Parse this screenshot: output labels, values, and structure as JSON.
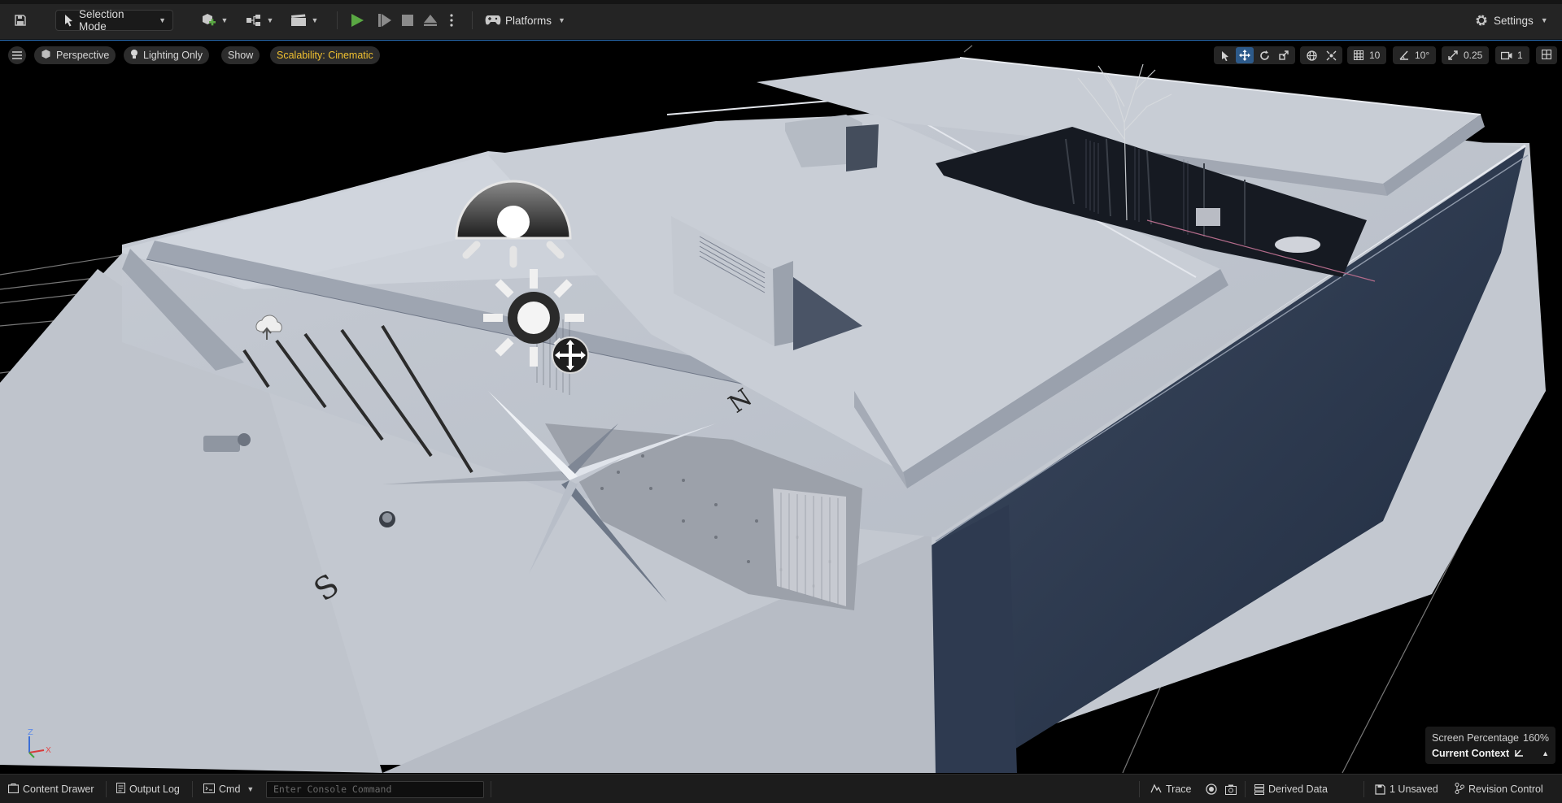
{
  "toolbar": {
    "mode_label": "Selection Mode",
    "platforms_label": "Platforms",
    "settings_label": "Settings"
  },
  "viewport": {
    "view_label": "Perspective",
    "lighting_label": "Lighting Only",
    "show_label": "Show",
    "scalability_label": "Scalability: Cinematic",
    "grid_snap_value": "10",
    "rotation_snap_value": "10°",
    "scale_snap_value": "0.25",
    "camera_speed_value": "1",
    "screen_percentage_label": "Screen Percentage",
    "screen_percentage_value": "160%",
    "context_label": "Current Context",
    "axis_z": "Z",
    "axis_x": "X"
  },
  "statusbar": {
    "content_drawer": "Content Drawer",
    "output_log": "Output Log",
    "cmd_label": "Cmd",
    "console_placeholder": "Enter Console Command",
    "trace_label": "Trace",
    "derived_data_label": "Derived Data",
    "unsaved_label": "1 Unsaved",
    "revision_control_label": "Revision Control"
  },
  "colors": {
    "accent_blue": "#2d5a8a",
    "play_green": "#5aa843",
    "scalability_yellow": "#f0c030",
    "model_light": "#c9ced6",
    "model_shadow": "#2a3548"
  },
  "icons": [
    "save-icon",
    "selection-mode-icon",
    "add-actor-icon",
    "blueprint-icon",
    "cinematics-icon",
    "play-icon",
    "advance-frame-icon",
    "stop-icon",
    "eject-icon",
    "more-options-icon",
    "platforms-icon",
    "settings-gear-icon",
    "hamburger-icon",
    "perspective-icon",
    "lighting-icon",
    "select-tool-icon",
    "translate-icon",
    "rotate-icon",
    "scale-icon",
    "world-space-icon",
    "surface-snap-icon",
    "grid-snap-icon",
    "rotation-snap-icon",
    "scale-snap-icon",
    "camera-speed-icon",
    "maximize-icon",
    "content-drawer-icon",
    "output-log-icon",
    "cmd-icon",
    "trace-icon",
    "revision-control-icon"
  ]
}
